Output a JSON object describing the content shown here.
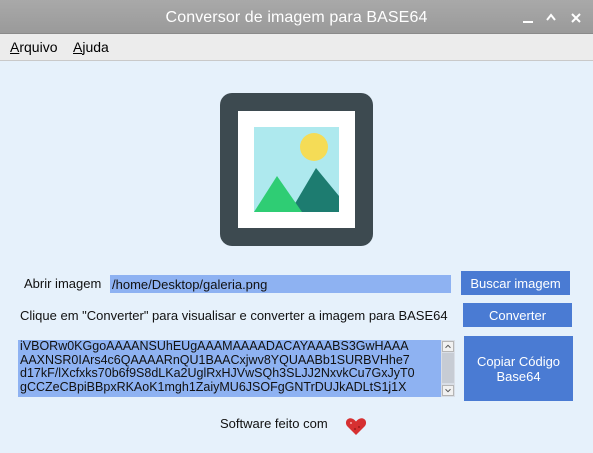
{
  "window": {
    "title": "Conversor de imagem para BASE64",
    "controls": [
      "minimize-icon",
      "maximize-icon",
      "close-icon"
    ]
  },
  "menu": {
    "items": [
      {
        "label": "Arquivo",
        "mnemonic": "A",
        "rest": "rquivo"
      },
      {
        "label": "Ajuda",
        "mnemonic": "A",
        "rest": "juda"
      }
    ]
  },
  "preview": {
    "icon": "image-placeholder-icon",
    "colors": {
      "frame": "#3d4a50",
      "sky": "#aee9ee",
      "sun": "#f5dc56",
      "mountain_front": "#2fcd74",
      "mountain_back": "#1d7c70"
    }
  },
  "open_image": {
    "label": "Abrir imagem",
    "path": "/home/Desktop/galeria.png",
    "button": "Buscar imagem"
  },
  "convert": {
    "instruction": "Clique em \"Converter\" para visualisar e converter a imagem para BASE64",
    "button": "Converter"
  },
  "output": {
    "text": "iVBORw0KGgoAAAANSUhEUgAAAMAAAADACAYAAABS3GwHAAA\nAAXNSR0IArs4c6QAAAARnQU1BAACxjwv8YQUAABb1SURBVHhe7\nd17kF/lXcfxks70b6f9S8dLKa2UglRxHJVwSQh3SLJJ2NxvkCu7GxJyT0\ngCCZeCBpiBBpxRKAoK1mgh1ZaiyMU6JSOFgGNTrDUJkADLtS1j1X",
    "copy_button": "Copiar Código Base64"
  },
  "footer": {
    "text": "Software feito com",
    "icon": "heart-icon",
    "heart_color": "#d63031"
  },
  "colors": {
    "background": "#e6f1fb",
    "button": "#4a7bd3",
    "field": "#8eb2f2"
  }
}
